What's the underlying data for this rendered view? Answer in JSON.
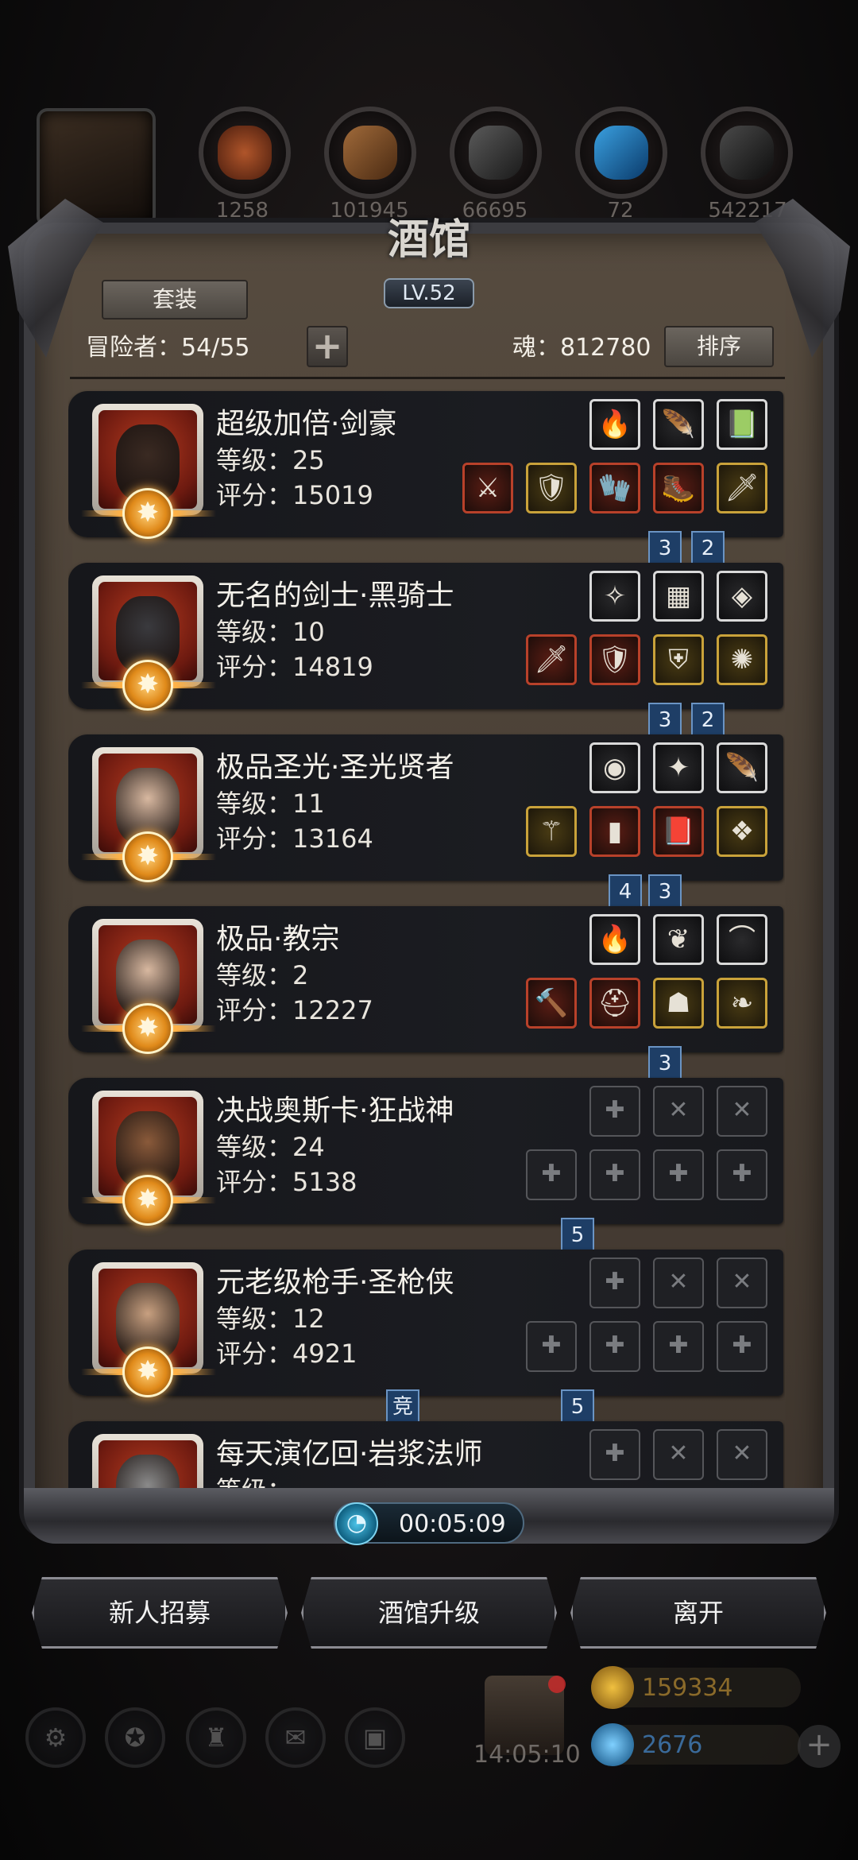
{
  "top_strip": {
    "resources": [
      {
        "icon": "leather-icon",
        "count": "1258"
      },
      {
        "icon": "wood-plank-icon",
        "count": "101945"
      },
      {
        "icon": "ingot-icon",
        "count": "66695"
      },
      {
        "icon": "crystal-feather-icon",
        "count": "72"
      },
      {
        "icon": "metal-scrap-icon",
        "count": "542217"
      }
    ]
  },
  "panel": {
    "title": "酒馆",
    "level": "LV.52",
    "set_button": "套装",
    "adventurers": "冒险者：54/55",
    "add_symbol": "+",
    "soul": "魂：812780",
    "sort_button": "排序"
  },
  "heroes": [
    {
      "name": "超级加倍·剑豪",
      "level": "等级：25",
      "score": "评分：15019",
      "top_gear": [
        {
          "q": "white",
          "g": "🔥"
        },
        {
          "q": "white",
          "g": "🪶"
        },
        {
          "q": "white",
          "g": "📗"
        }
      ],
      "bottom_gear": [
        {
          "q": "red",
          "g": "⚔"
        },
        {
          "q": "gold",
          "g": "🛡"
        },
        {
          "q": "red",
          "g": "🧤"
        },
        {
          "q": "red",
          "g": "🥾"
        },
        {
          "q": "gold",
          "g": "🗡"
        }
      ],
      "tags": [
        "3",
        "2"
      ]
    },
    {
      "name": "无名的剑士·黑骑士",
      "level": "等级：10",
      "score": "评分：14819",
      "top_gear": [
        {
          "q": "white",
          "g": "✧"
        },
        {
          "q": "white",
          "g": "▦"
        },
        {
          "q": "white",
          "g": "◈"
        }
      ],
      "bottom_gear": [
        {
          "q": "red",
          "g": "🗡"
        },
        {
          "q": "red",
          "g": "🛡"
        },
        {
          "q": "gold",
          "g": "⛨"
        },
        {
          "q": "gold",
          "g": "✺"
        }
      ],
      "tags": [
        "3",
        "2"
      ]
    },
    {
      "name": "极品圣光·圣光贤者",
      "level": "等级：11",
      "score": "评分：13164",
      "top_gear": [
        {
          "q": "white",
          "g": "◉"
        },
        {
          "q": "white",
          "g": "✦"
        },
        {
          "q": "white",
          "g": "🪶"
        }
      ],
      "bottom_gear": [
        {
          "q": "gold",
          "g": "⚚"
        },
        {
          "q": "red",
          "g": "▮"
        },
        {
          "q": "red",
          "g": "📕"
        },
        {
          "q": "gold",
          "g": "❖"
        }
      ],
      "tags": [
        "4",
        "3"
      ]
    },
    {
      "name": "极品·教宗",
      "level": "等级：2",
      "score": "评分：12227",
      "top_gear": [
        {
          "q": "white",
          "g": "🔥"
        },
        {
          "q": "white",
          "g": "❦"
        },
        {
          "q": "white",
          "g": "⌒"
        }
      ],
      "bottom_gear": [
        {
          "q": "red",
          "g": "🔨"
        },
        {
          "q": "red",
          "g": "⛑"
        },
        {
          "q": "gold",
          "g": "☗"
        },
        {
          "q": "gold",
          "g": "❧"
        }
      ],
      "tags": [
        "3"
      ]
    },
    {
      "name": "决战奥斯卡·狂战神",
      "level": "等级：24",
      "score": "评分：5138",
      "top_gear": [
        {
          "q": "empty",
          "g": "✚"
        },
        {
          "q": "empty",
          "g": "✕"
        },
        {
          "q": "empty",
          "g": "✕"
        }
      ],
      "bottom_gear": [
        {
          "q": "empty",
          "g": "✚"
        },
        {
          "q": "empty",
          "g": "✚"
        },
        {
          "q": "empty",
          "g": "✚"
        },
        {
          "q": "empty",
          "g": "✚"
        }
      ],
      "tags": [
        "5"
      ]
    },
    {
      "name": "元老级枪手·圣枪侠",
      "level": "等级：12",
      "score": "评分：4921",
      "top_gear": [
        {
          "q": "empty",
          "g": "✚"
        },
        {
          "q": "empty",
          "g": "✕"
        },
        {
          "q": "empty",
          "g": "✕"
        }
      ],
      "bottom_gear": [
        {
          "q": "empty",
          "g": "✚"
        },
        {
          "q": "empty",
          "g": "✚"
        },
        {
          "q": "empty",
          "g": "✚"
        },
        {
          "q": "empty",
          "g": "✚"
        }
      ],
      "tags": [
        "竞",
        "5"
      ]
    },
    {
      "name": "每天演亿回·岩浆法师",
      "level": "等级：",
      "score": "",
      "top_gear": [
        {
          "q": "empty",
          "g": "✚"
        },
        {
          "q": "empty",
          "g": "✕"
        },
        {
          "q": "empty",
          "g": "✕"
        }
      ],
      "bottom_gear": [],
      "tags": []
    }
  ],
  "timer": {
    "value": "00:05:09"
  },
  "actions": {
    "recruit": "新人招募",
    "upgrade": "酒馆升级",
    "leave": "离开"
  },
  "footer": {
    "clock": "14:05:10",
    "gold": "159334",
    "gems": "2676",
    "plus": "+",
    "nav_icons": [
      "gear-icon",
      "star-icon",
      "fortress-icon",
      "mail-icon",
      "chest-icon"
    ]
  },
  "colors": {
    "accent_tag": "#1e3e66",
    "panel": "#4a4036",
    "card": "#1b1c21"
  }
}
